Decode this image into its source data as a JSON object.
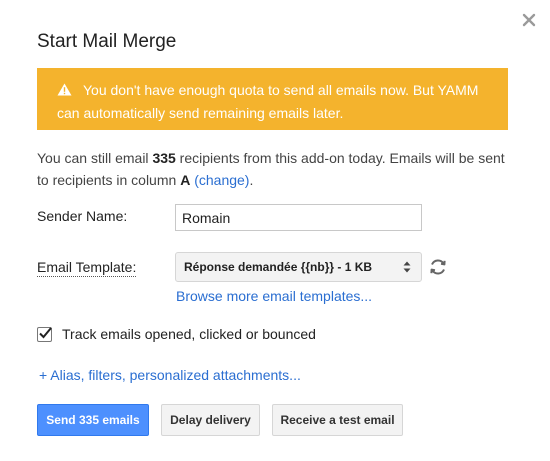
{
  "dialog": {
    "title": "Start Mail Merge",
    "close_icon": "close-icon"
  },
  "banner": {
    "icon": "warning-icon",
    "line1": "You don't have enough quota to send all emails now. But YAMM",
    "line2": "can automatically send remaining emails later.",
    "background_color": "#f4b32d"
  },
  "info": {
    "prefix": "You can still email ",
    "count": "335",
    "middle": " recipients from this add-on today. Emails will be sent",
    "line2_prefix": "to recipients in column ",
    "column": "A",
    "change_link": "(change)",
    "suffix": "."
  },
  "form": {
    "sender_label": "Sender Name:",
    "sender_value": "Romain",
    "template_label": "Email Template:",
    "template_selected": "Réponse demandée {{nb}} - 1 KB",
    "refresh_icon": "refresh-icon",
    "browse_link": "Browse more email templates...",
    "track_checked": true,
    "track_label": "Track emails opened, clicked or bounced",
    "alias_link": "+ Alias, filters, personalized attachments..."
  },
  "buttons": {
    "send": "Send 335 emails",
    "delay": "Delay delivery",
    "test": "Receive a test email"
  },
  "colors": {
    "primary_button": "#4d90fe",
    "link": "#2a6ed1"
  }
}
